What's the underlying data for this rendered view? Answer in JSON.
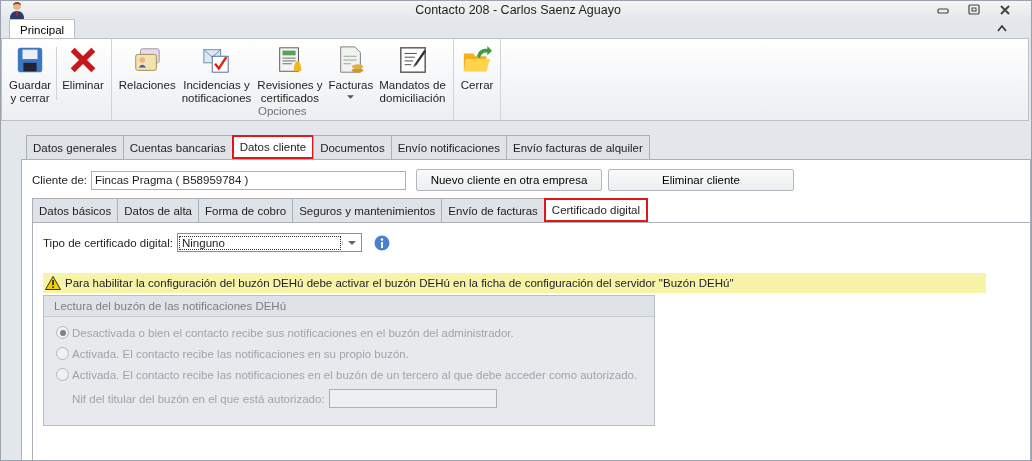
{
  "window": {
    "title": "Contacto 208 - Carlos Saenz Aguayo"
  },
  "ribbon_tabs": [
    {
      "label": "Principal",
      "selected": true
    }
  ],
  "ribbon_groups": [
    {
      "buttons": [
        {
          "lines": [
            "Guardar",
            "y cerrar"
          ]
        },
        {
          "lines": [
            "Eliminar"
          ]
        }
      ]
    },
    {
      "label": "Opciones",
      "buttons": [
        {
          "lines": [
            "Relaciones"
          ]
        },
        {
          "lines": [
            "Incidencias y",
            "notificaciones"
          ]
        },
        {
          "lines": [
            "Revisiones y",
            "certificados"
          ]
        },
        {
          "lines": [
            "Facturas"
          ],
          "dropdown": true
        },
        {
          "lines": [
            "Mandatos de",
            "domiciliación"
          ]
        }
      ]
    },
    {
      "buttons": [
        {
          "lines": [
            "Cerrar"
          ]
        }
      ]
    }
  ],
  "tabs": [
    {
      "label": "Datos generales",
      "selected": false
    },
    {
      "label": "Cuentas bancarias",
      "selected": false
    },
    {
      "label": "Datos cliente",
      "selected": true
    },
    {
      "label": "Documentos",
      "selected": false
    },
    {
      "label": "Envío notificaciones",
      "selected": false
    },
    {
      "label": "Envío facturas de alquiler",
      "selected": false
    }
  ],
  "client": {
    "label": "Cliente de:",
    "value": "Fincas Pragma ( B58959784 )",
    "buttons": [
      "Nuevo cliente en otra empresa",
      "Eliminar cliente"
    ]
  },
  "subtabs": [
    {
      "label": "Datos básicos",
      "selected": false
    },
    {
      "label": "Datos de alta",
      "selected": false
    },
    {
      "label": "Forma de cobro",
      "selected": false
    },
    {
      "label": "Seguros y mantenimientos",
      "selected": false
    },
    {
      "label": "Envío de facturas",
      "selected": false
    },
    {
      "label": "Certificado digital",
      "selected": true
    }
  ],
  "certificate": {
    "label": "Tipo de certificado digital:",
    "value": "Ninguno"
  },
  "warning": "Para habilitar la configuración del buzón DEHú debe activar el buzón DEHú en la ficha de configuración del servidor \"Buzón DEHú\"",
  "group": {
    "title": "Lectura del buzón de las notificaciones DEHú",
    "disabled": true,
    "options": [
      {
        "label": "Desactivada o bien el contacto recibe sus notificaciones en el buzón del administrador.",
        "selected": true
      },
      {
        "label": "Activada. El contacto recibe las notificaciones en su propio buzón.",
        "selected": false
      },
      {
        "label": "Activada. El contacto recibe las notificaciones en el buzón de un tercero al que debe acceder como autorizado.",
        "selected": false
      }
    ],
    "nif_label": "Nif del titular del buzón en el que está autorizado:"
  }
}
